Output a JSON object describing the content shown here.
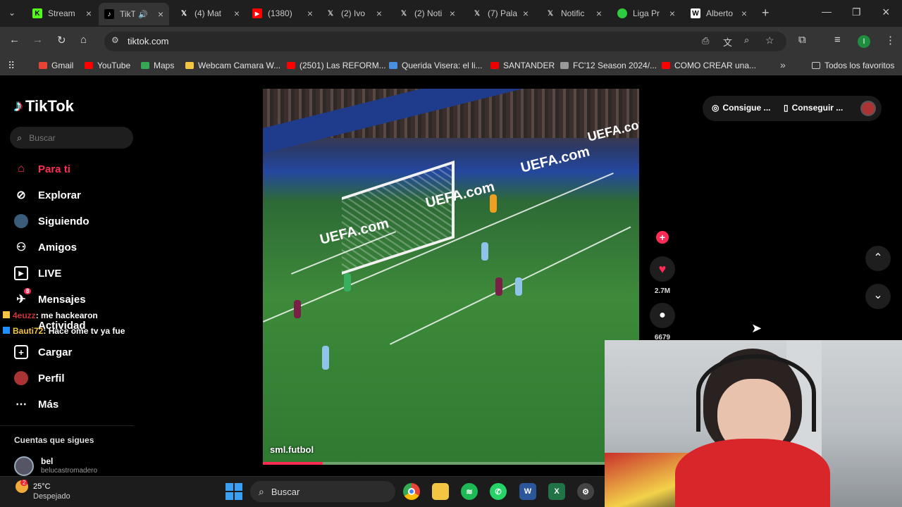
{
  "browser": {
    "tabs": [
      {
        "title": "Stream",
        "icon": "kick-icon",
        "color": "#53fc18"
      },
      {
        "title": "TikTok",
        "icon": "tiktok-icon",
        "color": "#ffffff",
        "active": true
      },
      {
        "title": "(4) Mat",
        "icon": "x-icon",
        "color": "#ffffff"
      },
      {
        "title": "(1380)",
        "icon": "youtube-icon",
        "color": "#ff0000"
      },
      {
        "title": "(2) Ivo",
        "icon": "x-icon",
        "color": "#ffffff"
      },
      {
        "title": "(2) Noti",
        "icon": "x-icon",
        "color": "#ffffff"
      },
      {
        "title": "(7) Pala",
        "icon": "x-icon",
        "color": "#ffffff"
      },
      {
        "title": "Notific",
        "icon": "x-icon",
        "color": "#ffffff"
      },
      {
        "title": "Liga Pr",
        "icon": "globe-icon",
        "color": "#2ecc40"
      },
      {
        "title": "Alberto",
        "icon": "wikipedia-icon",
        "color": "#ffffff"
      }
    ],
    "url": "tiktok.com",
    "bookmarks": [
      {
        "label": "Gmail",
        "color": "#ea4335"
      },
      {
        "label": "YouTube",
        "color": "#ff0000"
      },
      {
        "label": "Maps",
        "color": "#34a853"
      },
      {
        "label": "Webcam Camara W...",
        "color": "#f4c542"
      },
      {
        "label": "(2501) Las REFORM...",
        "color": "#ff0000"
      },
      {
        "label": "Querida Visera: el li...",
        "color": "#4a90e2"
      },
      {
        "label": "SANTANDER",
        "color": "#ec0000"
      },
      {
        "label": "FC'12 Season 2024/...",
        "color": "#999999"
      },
      {
        "label": "COMO CREAR una...",
        "color": "#ff0000"
      }
    ],
    "all_bookmarks": "Todos los favoritos",
    "profile_initial": "I"
  },
  "tiktok": {
    "logo": "TikTok",
    "search_placeholder": "Buscar",
    "nav": [
      {
        "label": "Para ti",
        "icon": "home-icon",
        "active": true
      },
      {
        "label": "Explorar",
        "icon": "compass-icon"
      },
      {
        "label": "Siguiendo",
        "icon": "following-avatar-icon"
      },
      {
        "label": "Amigos",
        "icon": "friends-icon"
      },
      {
        "label": "LIVE",
        "icon": "live-icon"
      },
      {
        "label": "Mensajes",
        "icon": "messages-icon",
        "badge": "8"
      },
      {
        "label": "Actividad",
        "icon": "activity-icon"
      },
      {
        "label": "Cargar",
        "icon": "upload-icon"
      },
      {
        "label": "Perfil",
        "icon": "profile-avatar-icon"
      },
      {
        "label": "Más",
        "icon": "more-icon"
      }
    ],
    "chat_overlay": [
      {
        "user": "4euzz",
        "text": ": me hackearon"
      },
      {
        "user": "Bauti72",
        "text": ": Hace ome tv ya fue"
      }
    ],
    "following_title": "Cuentas que sigues",
    "following": [
      {
        "name": "bel",
        "handle": "belucastromadero"
      }
    ],
    "top_buttons": [
      "Consigue ...",
      "Conseguir ..."
    ],
    "video": {
      "author": "sml.futbol",
      "ads": [
        "UEFA.com",
        "UEFA.com",
        "UEFA.com",
        "UEFA.com"
      ],
      "progress": 0.16
    },
    "likes": "2.7M",
    "comments": "6679"
  },
  "taskbar": {
    "weather_temp": "25°C",
    "weather_desc": "Despejado",
    "weather_badge": "2",
    "search_placeholder": "Buscar"
  }
}
